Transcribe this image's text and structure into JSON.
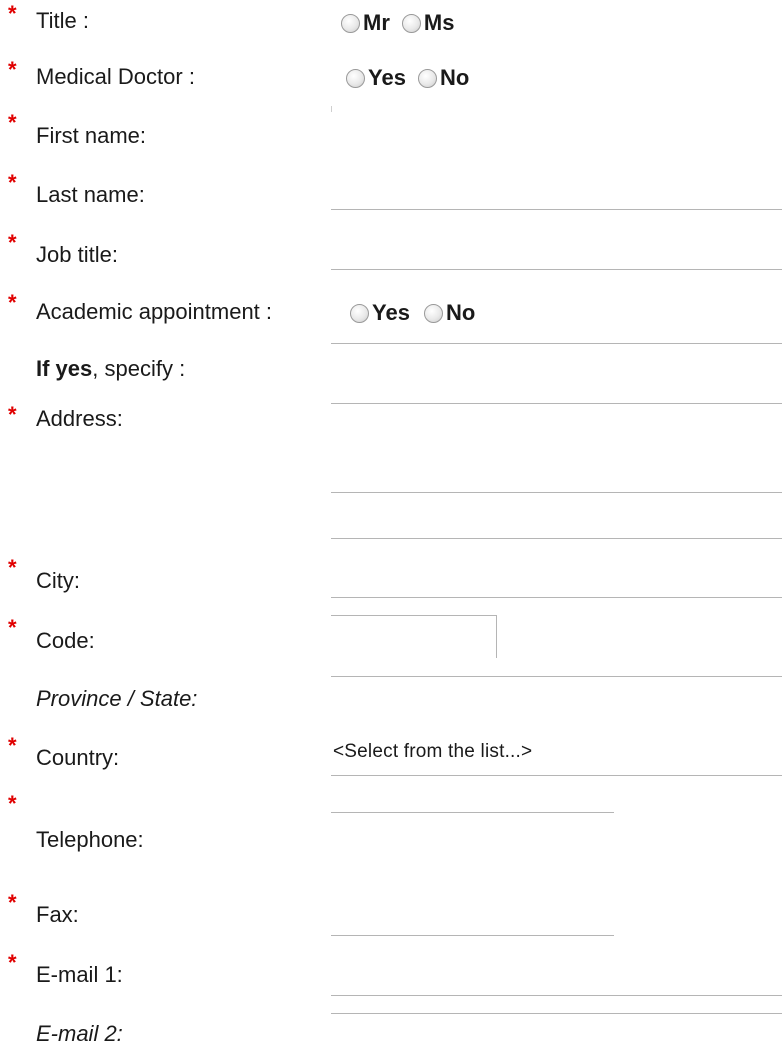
{
  "form": {
    "required_marker": "*",
    "title": {
      "label": "Title :",
      "options": [
        "Mr",
        "Ms"
      ]
    },
    "medical_doctor": {
      "label": "Medical Doctor :",
      "options": [
        "Yes",
        "No"
      ]
    },
    "first_name": {
      "label": "First name:",
      "value": ""
    },
    "last_name": {
      "label": "Last name:",
      "value": ""
    },
    "job_title": {
      "label": "Job title:",
      "value": ""
    },
    "academic_appointment": {
      "label": "Academic appointment :",
      "options": [
        "Yes",
        "No"
      ]
    },
    "if_yes": {
      "label_bold": "If yes",
      "label_rest": ", specify :",
      "value": ""
    },
    "address": {
      "label": "Address:",
      "lines": [
        "",
        "",
        ""
      ]
    },
    "city": {
      "label": "City:",
      "value": ""
    },
    "code": {
      "label": "Code:",
      "value": ""
    },
    "province_state": {
      "label": "Province / State:",
      "value": ""
    },
    "country": {
      "label": "Country:",
      "selected": "<Select from the list...>"
    },
    "telephone": {
      "label": "Telephone:",
      "value": ""
    },
    "fax": {
      "label": "Fax:",
      "value": ""
    },
    "email1": {
      "label": "E-mail 1:",
      "value": ""
    },
    "email2": {
      "label": "E-mail 2:",
      "value": ""
    }
  },
  "colors": {
    "required": "#e00000",
    "field_line": "#b5b5b5"
  }
}
